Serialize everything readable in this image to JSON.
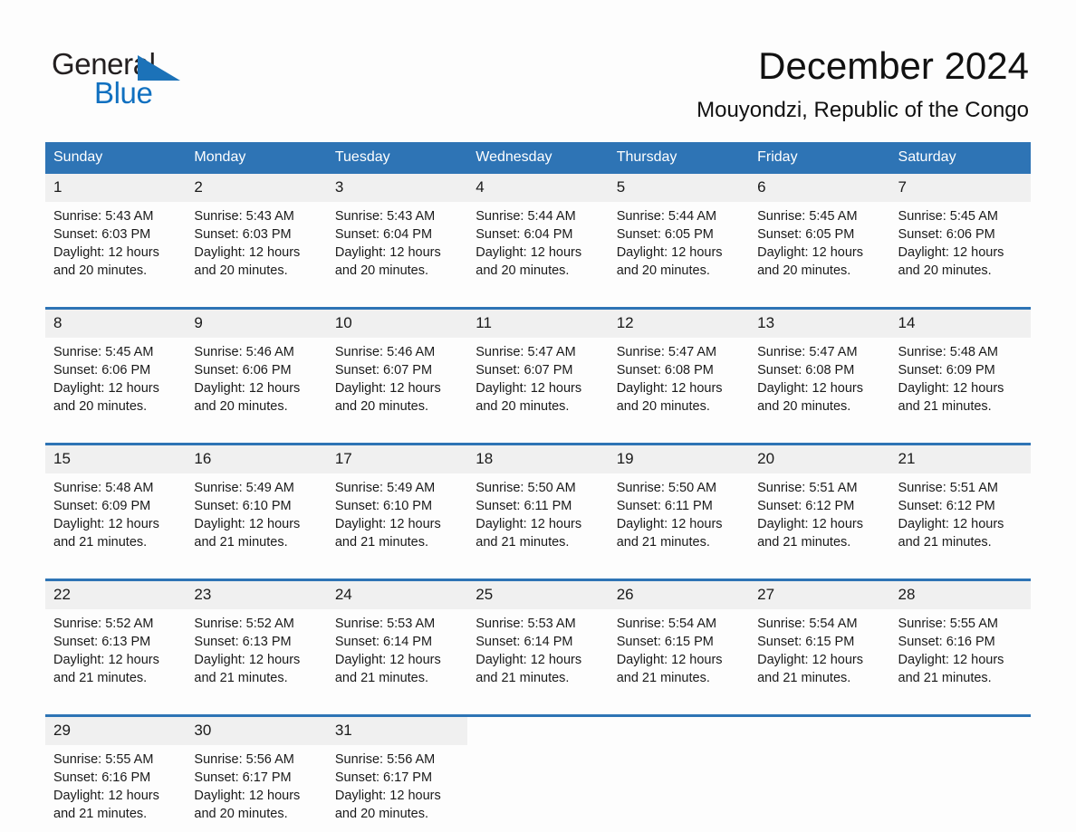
{
  "brand": {
    "name_part1": "General",
    "name_part2": "Blue",
    "logo_icon": "triangle-flag-icon",
    "accent_color": "#1c72b8"
  },
  "header": {
    "title": "December 2024",
    "subtitle": "Mouyondzi, Republic of the Congo"
  },
  "theme": {
    "header_blue": "#2e74b5",
    "daynum_band": "#f0f0f0",
    "page_background": "#fdfdfd"
  },
  "weekday_headers": [
    "Sunday",
    "Monday",
    "Tuesday",
    "Wednesday",
    "Thursday",
    "Friday",
    "Saturday"
  ],
  "labels": {
    "sunrise_prefix": "Sunrise:",
    "sunset_prefix": "Sunset:",
    "daylight_prefix": "Daylight:"
  },
  "weeks": [
    {
      "days": [
        {
          "date": "1",
          "sunrise": "Sunrise: 5:43 AM",
          "sunset": "Sunset: 6:03 PM",
          "daylight_l1": "Daylight: 12 hours",
          "daylight_l2": "and 20 minutes."
        },
        {
          "date": "2",
          "sunrise": "Sunrise: 5:43 AM",
          "sunset": "Sunset: 6:03 PM",
          "daylight_l1": "Daylight: 12 hours",
          "daylight_l2": "and 20 minutes."
        },
        {
          "date": "3",
          "sunrise": "Sunrise: 5:43 AM",
          "sunset": "Sunset: 6:04 PM",
          "daylight_l1": "Daylight: 12 hours",
          "daylight_l2": "and 20 minutes."
        },
        {
          "date": "4",
          "sunrise": "Sunrise: 5:44 AM",
          "sunset": "Sunset: 6:04 PM",
          "daylight_l1": "Daylight: 12 hours",
          "daylight_l2": "and 20 minutes."
        },
        {
          "date": "5",
          "sunrise": "Sunrise: 5:44 AM",
          "sunset": "Sunset: 6:05 PM",
          "daylight_l1": "Daylight: 12 hours",
          "daylight_l2": "and 20 minutes."
        },
        {
          "date": "6",
          "sunrise": "Sunrise: 5:45 AM",
          "sunset": "Sunset: 6:05 PM",
          "daylight_l1": "Daylight: 12 hours",
          "daylight_l2": "and 20 minutes."
        },
        {
          "date": "7",
          "sunrise": "Sunrise: 5:45 AM",
          "sunset": "Sunset: 6:06 PM",
          "daylight_l1": "Daylight: 12 hours",
          "daylight_l2": "and 20 minutes."
        }
      ]
    },
    {
      "days": [
        {
          "date": "8",
          "sunrise": "Sunrise: 5:45 AM",
          "sunset": "Sunset: 6:06 PM",
          "daylight_l1": "Daylight: 12 hours",
          "daylight_l2": "and 20 minutes."
        },
        {
          "date": "9",
          "sunrise": "Sunrise: 5:46 AM",
          "sunset": "Sunset: 6:06 PM",
          "daylight_l1": "Daylight: 12 hours",
          "daylight_l2": "and 20 minutes."
        },
        {
          "date": "10",
          "sunrise": "Sunrise: 5:46 AM",
          "sunset": "Sunset: 6:07 PM",
          "daylight_l1": "Daylight: 12 hours",
          "daylight_l2": "and 20 minutes."
        },
        {
          "date": "11",
          "sunrise": "Sunrise: 5:47 AM",
          "sunset": "Sunset: 6:07 PM",
          "daylight_l1": "Daylight: 12 hours",
          "daylight_l2": "and 20 minutes."
        },
        {
          "date": "12",
          "sunrise": "Sunrise: 5:47 AM",
          "sunset": "Sunset: 6:08 PM",
          "daylight_l1": "Daylight: 12 hours",
          "daylight_l2": "and 20 minutes."
        },
        {
          "date": "13",
          "sunrise": "Sunrise: 5:47 AM",
          "sunset": "Sunset: 6:08 PM",
          "daylight_l1": "Daylight: 12 hours",
          "daylight_l2": "and 20 minutes."
        },
        {
          "date": "14",
          "sunrise": "Sunrise: 5:48 AM",
          "sunset": "Sunset: 6:09 PM",
          "daylight_l1": "Daylight: 12 hours",
          "daylight_l2": "and 21 minutes."
        }
      ]
    },
    {
      "days": [
        {
          "date": "15",
          "sunrise": "Sunrise: 5:48 AM",
          "sunset": "Sunset: 6:09 PM",
          "daylight_l1": "Daylight: 12 hours",
          "daylight_l2": "and 21 minutes."
        },
        {
          "date": "16",
          "sunrise": "Sunrise: 5:49 AM",
          "sunset": "Sunset: 6:10 PM",
          "daylight_l1": "Daylight: 12 hours",
          "daylight_l2": "and 21 minutes."
        },
        {
          "date": "17",
          "sunrise": "Sunrise: 5:49 AM",
          "sunset": "Sunset: 6:10 PM",
          "daylight_l1": "Daylight: 12 hours",
          "daylight_l2": "and 21 minutes."
        },
        {
          "date": "18",
          "sunrise": "Sunrise: 5:50 AM",
          "sunset": "Sunset: 6:11 PM",
          "daylight_l1": "Daylight: 12 hours",
          "daylight_l2": "and 21 minutes."
        },
        {
          "date": "19",
          "sunrise": "Sunrise: 5:50 AM",
          "sunset": "Sunset: 6:11 PM",
          "daylight_l1": "Daylight: 12 hours",
          "daylight_l2": "and 21 minutes."
        },
        {
          "date": "20",
          "sunrise": "Sunrise: 5:51 AM",
          "sunset": "Sunset: 6:12 PM",
          "daylight_l1": "Daylight: 12 hours",
          "daylight_l2": "and 21 minutes."
        },
        {
          "date": "21",
          "sunrise": "Sunrise: 5:51 AM",
          "sunset": "Sunset: 6:12 PM",
          "daylight_l1": "Daylight: 12 hours",
          "daylight_l2": "and 21 minutes."
        }
      ]
    },
    {
      "days": [
        {
          "date": "22",
          "sunrise": "Sunrise: 5:52 AM",
          "sunset": "Sunset: 6:13 PM",
          "daylight_l1": "Daylight: 12 hours",
          "daylight_l2": "and 21 minutes."
        },
        {
          "date": "23",
          "sunrise": "Sunrise: 5:52 AM",
          "sunset": "Sunset: 6:13 PM",
          "daylight_l1": "Daylight: 12 hours",
          "daylight_l2": "and 21 minutes."
        },
        {
          "date": "24",
          "sunrise": "Sunrise: 5:53 AM",
          "sunset": "Sunset: 6:14 PM",
          "daylight_l1": "Daylight: 12 hours",
          "daylight_l2": "and 21 minutes."
        },
        {
          "date": "25",
          "sunrise": "Sunrise: 5:53 AM",
          "sunset": "Sunset: 6:14 PM",
          "daylight_l1": "Daylight: 12 hours",
          "daylight_l2": "and 21 minutes."
        },
        {
          "date": "26",
          "sunrise": "Sunrise: 5:54 AM",
          "sunset": "Sunset: 6:15 PM",
          "daylight_l1": "Daylight: 12 hours",
          "daylight_l2": "and 21 minutes."
        },
        {
          "date": "27",
          "sunrise": "Sunrise: 5:54 AM",
          "sunset": "Sunset: 6:15 PM",
          "daylight_l1": "Daylight: 12 hours",
          "daylight_l2": "and 21 minutes."
        },
        {
          "date": "28",
          "sunrise": "Sunrise: 5:55 AM",
          "sunset": "Sunset: 6:16 PM",
          "daylight_l1": "Daylight: 12 hours",
          "daylight_l2": "and 21 minutes."
        }
      ]
    },
    {
      "days": [
        {
          "date": "29",
          "sunrise": "Sunrise: 5:55 AM",
          "sunset": "Sunset: 6:16 PM",
          "daylight_l1": "Daylight: 12 hours",
          "daylight_l2": "and 21 minutes."
        },
        {
          "date": "30",
          "sunrise": "Sunrise: 5:56 AM",
          "sunset": "Sunset: 6:17 PM",
          "daylight_l1": "Daylight: 12 hours",
          "daylight_l2": "and 20 minutes."
        },
        {
          "date": "31",
          "sunrise": "Sunrise: 5:56 AM",
          "sunset": "Sunset: 6:17 PM",
          "daylight_l1": "Daylight: 12 hours",
          "daylight_l2": "and 20 minutes."
        },
        {
          "date": "",
          "sunrise": "",
          "sunset": "",
          "daylight_l1": "",
          "daylight_l2": ""
        },
        {
          "date": "",
          "sunrise": "",
          "sunset": "",
          "daylight_l1": "",
          "daylight_l2": ""
        },
        {
          "date": "",
          "sunrise": "",
          "sunset": "",
          "daylight_l1": "",
          "daylight_l2": ""
        },
        {
          "date": "",
          "sunrise": "",
          "sunset": "",
          "daylight_l1": "",
          "daylight_l2": ""
        }
      ]
    }
  ]
}
